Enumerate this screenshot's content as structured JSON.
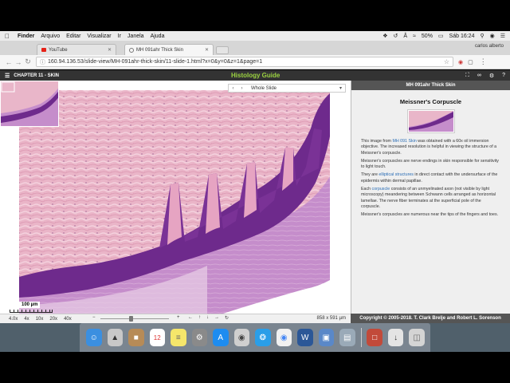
{
  "menubar": {
    "items": [
      "Finder",
      "Arquivo",
      "Editar",
      "Visualizar",
      "Ir",
      "Janela",
      "Ajuda"
    ],
    "battery": "50%",
    "clock": "Sáb 16:24"
  },
  "browser": {
    "tabs": [
      {
        "title": "YouTube"
      },
      {
        "title": "MH 091ahr Thick Skin"
      }
    ],
    "profile": "carlos alberto",
    "url": "160.94.136.53/slide-view/MH-091ahr-thick-skin/11-slide-1.html?x=0&y=0&z=1&page=1"
  },
  "app": {
    "chapter": "CHAPTER 11 - SKIN",
    "title": "Histology Guide",
    "slide_selector": "Whole Slide",
    "scale_label": "100 µm",
    "magnification": "4.0x",
    "zoom_buttons": [
      "4x",
      "10x",
      "20x",
      "40x"
    ],
    "dimensions": "858 x 591 µm"
  },
  "panel": {
    "header": "MH 091ahr Thick Skin",
    "heading": "Meissner's Corpuscle",
    "p1_pre": "This image from ",
    "p1_link": "MH 091 Skin",
    "p1_post": " was obtained with a 60x oil immersion objective. The increased resolution is helpful in viewing the structure of a Meissner's corpuscle.",
    "p2": "Meissner's corpuscles are nerve endings in skin responsible for sensitivity to light touch.",
    "p3_pre": "They are ",
    "p3_link": "elliptical structures",
    "p3_post": " in direct contact with the undersurface of the epidermis within dermal papillae.",
    "p4_pre": "Each ",
    "p4_link": "corpuscle",
    "p4_post": " consists of an unmyelinated axon (not visible by light microscopy) meandering between Schwann cells arranged as horizontal lamellae. The nerve fiber terminates at the superficial pole of the corpuscle.",
    "p5": "Meissner's corpuscles are numerous near the tips of the fingers and toes.",
    "copyright": "Copyright © 2005-2018. T. Clark Brelje and Robert L. Sorenson"
  },
  "colors": {
    "accent": "#9bd240",
    "header_bg": "#333333",
    "panel_header_bg": "#555555",
    "link": "#2a6db5",
    "dermis": "#eab5c8",
    "epidermis": "#6e2a8c",
    "stratum_lucidum": "#c890cc"
  }
}
